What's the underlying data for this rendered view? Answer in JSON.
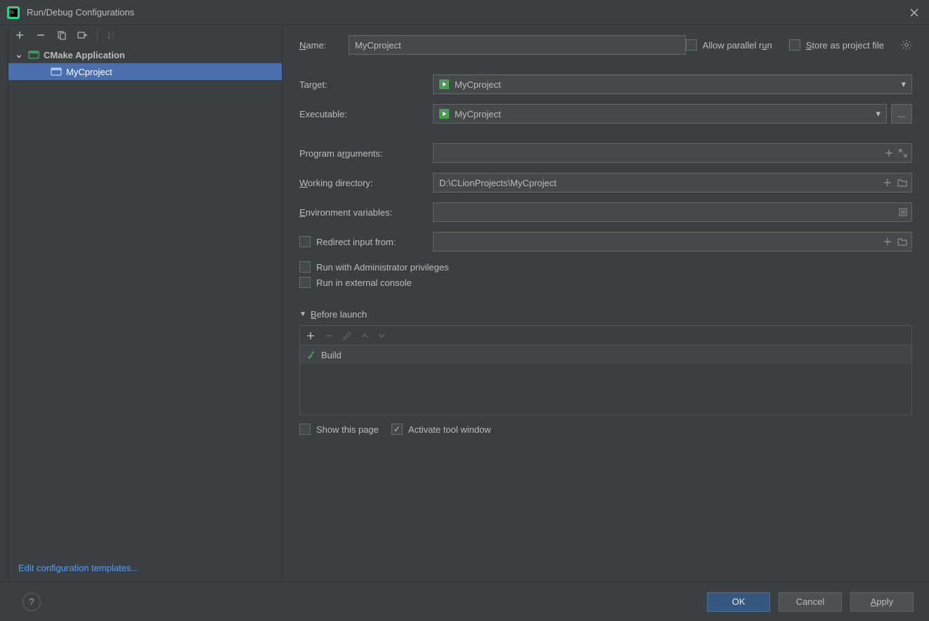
{
  "window": {
    "title": "Run/Debug Configurations"
  },
  "tree": {
    "root_label": "CMake Application",
    "child_label": "MyCproject"
  },
  "sidebar": {
    "edit_templates": "Edit configuration templates..."
  },
  "form": {
    "name_label": "Name:",
    "name_value": "MyCproject",
    "allow_parallel": "Allow parallel run",
    "store_as_project": "Store as project file",
    "target_label": "Target:",
    "target_value": "MyCproject",
    "executable_label": "Executable:",
    "executable_value": "MyCproject",
    "browse_label": "...",
    "program_args_label": "Program arguments:",
    "program_args_value": "",
    "working_dir_label": "Working directory:",
    "working_dir_value": "D:\\CLionProjects\\MyCproject",
    "env_vars_label": "Environment variables:",
    "env_vars_value": "",
    "redirect_label": "Redirect input from:",
    "redirect_value": "",
    "admin_priv": "Run with Administrator privileges",
    "external_console": "Run in external console",
    "before_launch_label": "Before launch",
    "build_label": "Build",
    "show_this_page": "Show this page",
    "activate_tool_window": "Activate tool window"
  },
  "buttons": {
    "ok": "OK",
    "cancel": "Cancel",
    "apply": "Apply"
  }
}
